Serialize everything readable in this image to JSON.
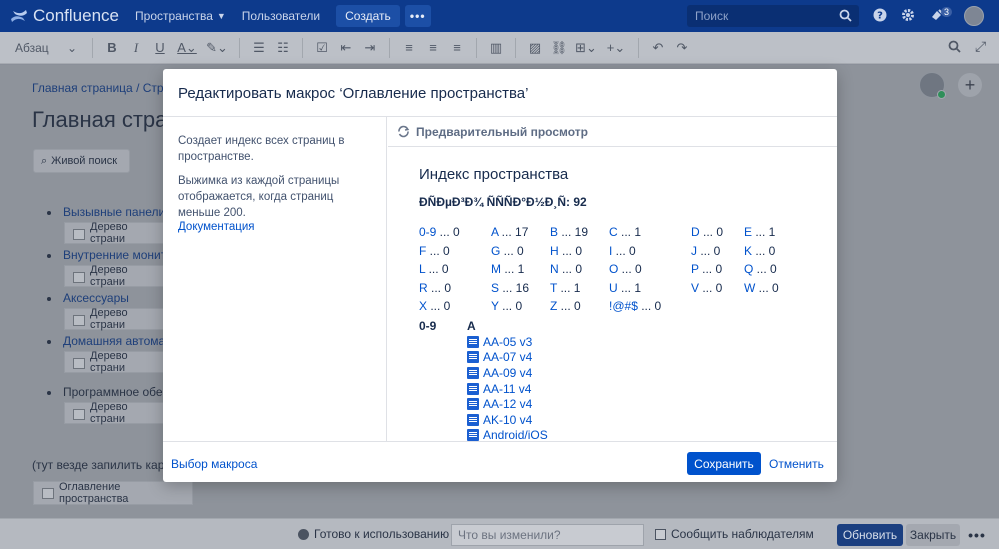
{
  "topnav": {
    "logo_text": "Confluence",
    "spaces": "Пространства",
    "users": "Пользователи",
    "create": "Создать",
    "more": "•••",
    "search_placeholder": "Поиск",
    "notifications_count": "3"
  },
  "toolbar": {
    "paragraph_style": "Абзац"
  },
  "page": {
    "breadcrumb": "Главная страница / Стра",
    "title": "Главная стран",
    "live_search": "Живой поиск",
    "tree": [
      {
        "label": "Вызывные панели",
        "macro": "Дерево страни"
      },
      {
        "label": "Внутренние монит",
        "macro": "Дерево страни"
      },
      {
        "label": "Аксессуары",
        "macro": "Дерево страни"
      },
      {
        "label": "Домашняя автомат",
        "macro": "Дерево страни"
      },
      {
        "label": "Программное обес",
        "macro": "Дерево страни"
      }
    ],
    "note": "(тут везде запилить карт",
    "space_index_placeholder": "Оглавление пространства"
  },
  "bottombar": {
    "ready": "Готово к использованию",
    "change_placeholder": "Что вы изменили?",
    "notify": "Сообщить наблюдателям",
    "update": "Обновить",
    "close": "Закрыть",
    "more": "•••"
  },
  "modal": {
    "title": "Редактировать макрос ‘Оглавление пространства’",
    "desc1": "Создает индекс всех страниц в пространстве.",
    "desc2": "Выжимка из каждой страницы отображается, когда страниц меньше 200.",
    "docs_link": "Документация",
    "preview_label": "Предварительный просмотр",
    "preview": {
      "title": "Индекс пространства",
      "total": "ÐÑÐµÐ³Ð¾ ÑÑÑÐ°Ð½Ð¸Ñ: 92",
      "letters": [
        {
          "k": "0-9",
          "v": " ... 0"
        },
        {
          "k": "A",
          "v": " ... 17"
        },
        {
          "k": "B",
          "v": " ... 19"
        },
        {
          "k": "C",
          "v": " ... 1"
        },
        {
          "k": "D",
          "v": " ... 0"
        },
        {
          "k": "E",
          "v": " ... 1"
        },
        {
          "k": "F",
          "v": " ... 0"
        },
        {
          "k": "G",
          "v": " ... 0"
        },
        {
          "k": "H",
          "v": " ... 0"
        },
        {
          "k": "I",
          "v": " ... 0"
        },
        {
          "k": "J",
          "v": " ... 0"
        },
        {
          "k": "K",
          "v": " ... 0"
        },
        {
          "k": "L",
          "v": " ... 0"
        },
        {
          "k": "M",
          "v": " ... 1"
        },
        {
          "k": "N",
          "v": " ... 0"
        },
        {
          "k": "O",
          "v": " ... 0"
        },
        {
          "k": "P",
          "v": " ... 0"
        },
        {
          "k": "Q",
          "v": " ... 0"
        },
        {
          "k": "R",
          "v": " ... 0"
        },
        {
          "k": "S",
          "v": " ... 16"
        },
        {
          "k": "T",
          "v": " ... 1"
        },
        {
          "k": "U",
          "v": " ... 1"
        },
        {
          "k": "V",
          "v": " ... 0"
        },
        {
          "k": "W",
          "v": " ... 0"
        },
        {
          "k": "X",
          "v": " ... 0"
        },
        {
          "k": "Y",
          "v": " ... 0"
        },
        {
          "k": "Z",
          "v": " ... 0"
        },
        {
          "k": "!@#$",
          "v": " ... 0"
        }
      ],
      "col_09": "0-9",
      "col_a": "A",
      "pages_a": [
        "AA-05 v3",
        "AA-07 v4",
        "AA-09 v4",
        "AA-11 v4",
        "AA-12 v4",
        "AK-10 v4",
        "Android/iOS"
      ]
    },
    "macro_browser": "Выбор макроса",
    "save": "Сохранить",
    "cancel": "Отменить"
  },
  "colors": {
    "accent": "#0052cc",
    "nav_bg": "#0d3a8c"
  }
}
